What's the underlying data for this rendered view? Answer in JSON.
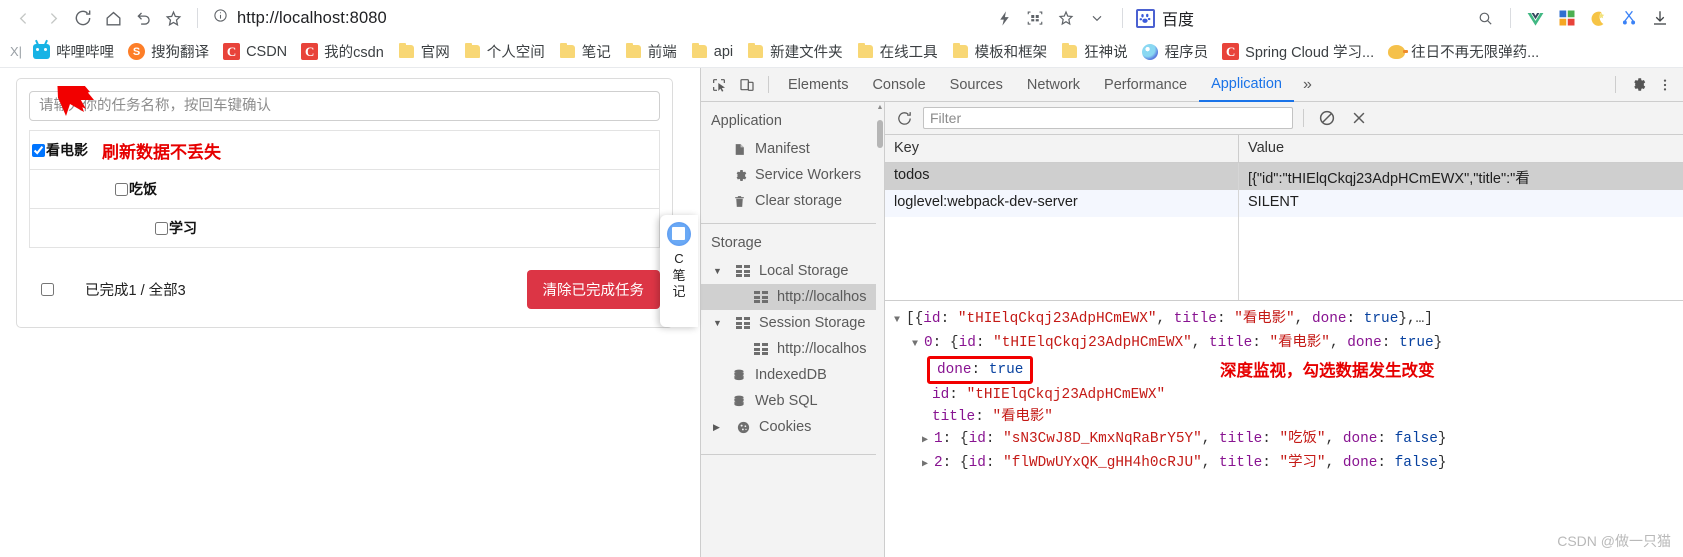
{
  "browser": {
    "nav": {
      "back": "back-arrow",
      "forward": "forward-arrow",
      "reload": "reload-icon",
      "home": "home-icon",
      "undo": "undo-icon",
      "bookmark": "star-icon"
    },
    "omnibox": {
      "info_icon": "info-circle-icon",
      "url_scheme": "http://",
      "url_host": "localhost",
      "url_port": ":8080",
      "url_full": "http://localhost:8080"
    },
    "right_icons": [
      "lightning-icon",
      "qr-code-icon",
      "star-outline-icon",
      "chevron-down-icon"
    ],
    "search_engine_chip": {
      "label": "百度",
      "icon": "baidu-paw-icon"
    },
    "far_right_icons": [
      "search-icon",
      "vue-devtools-icon",
      "color-grid-icon",
      "moon-icon",
      "scissors-icon",
      "download-icon"
    ]
  },
  "bookmarks": {
    "leading": "X|",
    "items": [
      {
        "label": "哔哩哔哩",
        "icon": "bilibili-icon"
      },
      {
        "label": "搜狗翻译",
        "icon": "sogou-icon"
      },
      {
        "label": "CSDN",
        "icon": "csdn-icon"
      },
      {
        "label": "我的csdn",
        "icon": "csdn-icon"
      },
      {
        "label": "官网",
        "icon": "folder-icon"
      },
      {
        "label": "个人空间",
        "icon": "folder-icon"
      },
      {
        "label": "笔记",
        "icon": "folder-icon"
      },
      {
        "label": "前端",
        "icon": "folder-icon"
      },
      {
        "label": "api",
        "icon": "folder-icon"
      },
      {
        "label": "新建文件夹",
        "icon": "folder-icon"
      },
      {
        "label": "在线工具",
        "icon": "folder-icon"
      },
      {
        "label": "模板和框架",
        "icon": "folder-icon"
      },
      {
        "label": "狂神说",
        "icon": "folder-icon"
      },
      {
        "label": "程序员",
        "icon": "cyan-circle-icon"
      },
      {
        "label": "Spring Cloud 学习...",
        "icon": "csdn-icon"
      },
      {
        "label": "往日不再无限弹药...",
        "icon": "duck-icon"
      }
    ]
  },
  "todo_app": {
    "input_placeholder": "请输入你的任务名称，按回车键确认",
    "input_value": "",
    "annotation": "刷新数据不丢失",
    "items": [
      {
        "title": "看电影",
        "done": true
      },
      {
        "title": "吃饭",
        "done": false
      },
      {
        "title": "学习",
        "done": false
      }
    ],
    "footer": {
      "select_all_checked": false,
      "summary": "已完成1 / 全部3",
      "clear_button": "清除已完成任务",
      "clear_button_color": "#dc3545"
    }
  },
  "note_badge": {
    "icon": "note-pencil-icon",
    "label": "C\n笔\n记",
    "line1": "C",
    "line2": "笔",
    "line3": "记"
  },
  "devtools": {
    "toolbar_icons": [
      "inspect-element-icon",
      "device-toolbar-icon"
    ],
    "tabs": [
      {
        "label": "Elements",
        "active": false
      },
      {
        "label": "Console",
        "active": false
      },
      {
        "label": "Sources",
        "active": false
      },
      {
        "label": "Network",
        "active": false
      },
      {
        "label": "Performance",
        "active": false
      },
      {
        "label": "Application",
        "active": true
      }
    ],
    "more_tabs": "»",
    "right_icons": [
      "gear-icon",
      "kebab-menu-icon"
    ],
    "sidebar": {
      "group1_title": "Application",
      "group1_items": [
        {
          "label": "Manifest",
          "icon": "document-icon"
        },
        {
          "label": "Service Workers",
          "icon": "gear-icon"
        },
        {
          "label": "Clear storage",
          "icon": "trash-icon"
        }
      ],
      "group2_title": "Storage",
      "group2_items": [
        {
          "label": "Local Storage",
          "icon": "grid-icon",
          "expanded": true,
          "depth": 0,
          "selected": false
        },
        {
          "label": "http://localhos",
          "icon": "grid-icon",
          "depth": 1,
          "selected": true
        },
        {
          "label": "Session Storage",
          "icon": "grid-icon",
          "expanded": true,
          "depth": 0,
          "selected": false
        },
        {
          "label": "http://localhos",
          "icon": "grid-icon",
          "depth": 1,
          "selected": false
        },
        {
          "label": "IndexedDB",
          "icon": "database-icon",
          "depth": 0,
          "selected": false
        },
        {
          "label": "Web SQL",
          "icon": "database-icon",
          "depth": 0,
          "selected": false
        },
        {
          "label": "Cookies",
          "icon": "cookie-icon",
          "collapsed": true,
          "depth": 0,
          "selected": false
        }
      ]
    },
    "subtoolbar": {
      "refresh_icon": "refresh-icon",
      "filter_placeholder": "Filter",
      "filter_value": "",
      "clear_icon": "no-entry-icon",
      "delete_icon": "x-icon"
    },
    "storage_table": {
      "columns": [
        "Key",
        "Value"
      ],
      "rows": [
        {
          "key": "todos",
          "value": "[{\"id\":\"tHIElqCkqj23AdpHCmEWX\",\"title\":\"看",
          "selected": true
        },
        {
          "key": "loglevel:webpack-dev-server",
          "value": "SILENT",
          "selected": false
        }
      ]
    },
    "preview": {
      "annotation": "深度监视，勾选数据发生改变",
      "lines": [
        {
          "tri": "open",
          "indent": 0,
          "text": "[{id: \"tHIElqCkqj23AdpHCmEWX\", title: \"看电影\", done: true},…]"
        },
        {
          "tri": "open",
          "indent": 1,
          "text": "0: {id: \"tHIElqCkqj23AdpHCmEWX\", title: \"看电影\", done: true}"
        },
        {
          "tri": "none",
          "indent": 2,
          "text": "done: true",
          "boxed": true
        },
        {
          "tri": "none",
          "indent": 2,
          "text": "id: \"tHIElqCkqj23AdpHCmEWX\""
        },
        {
          "tri": "none",
          "indent": 2,
          "text": "title: \"看电影\""
        },
        {
          "tri": "closed",
          "indent": 1,
          "text": "1: {id: \"sN3CwJ8D_KmxNqRaBrY5Y\", title: \"吃饭\", done: false}"
        },
        {
          "tri": "closed",
          "indent": 1,
          "text": "2: {id: \"flWDwUYxQK_gHH4h0cRJU\", title: \"学习\", done: false}"
        }
      ]
    }
  },
  "watermark": "CSDN @做一只猫",
  "colors": {
    "accent_blue": "#1a73e8",
    "danger_red": "#dc3545",
    "annotation_red": "#e60000",
    "devtools_bg": "#f3f3f3"
  }
}
